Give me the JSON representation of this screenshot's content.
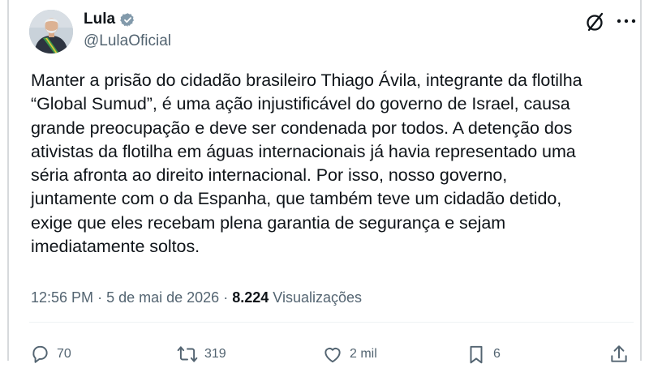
{
  "tweet": {
    "author_name": "Lula",
    "author_handle": "@LulaOficial",
    "text": "Manter a prisão do cidadão brasileiro Thiago Ávila, integrante da flotilha\n“Global Sumud”, é uma ação injustificável do governo de Israel, causa\ngrande preocupação e deve ser condenada por todos. A detenção dos\nativistas da flotilha em águas internacionais já havia representado uma\nséria afronta ao direito internacional. Por isso, nosso governo,\njuntamente com o da Espanha, que também teve um cidadão detido,\nexige que eles recebam plena garantia de segurança e sejam\nimediatamente soltos.",
    "time": "12:56 PM",
    "sep1": "·",
    "date": "5 de mai de 2026",
    "sep2": "·",
    "views_count": "8.224",
    "views_label": "Visualizações"
  },
  "actions": {
    "replies": "70",
    "reposts": "319",
    "likes": "2 mil",
    "bookmarks": "6"
  },
  "icons": [
    "verified-badge-icon",
    "grok-icon",
    "more-icon",
    "reply-icon",
    "repost-icon",
    "like-icon",
    "bookmark-icon",
    "share-icon"
  ],
  "colors": {
    "text": "#0f1419",
    "secondary": "#536471",
    "verified": "#829aab"
  }
}
